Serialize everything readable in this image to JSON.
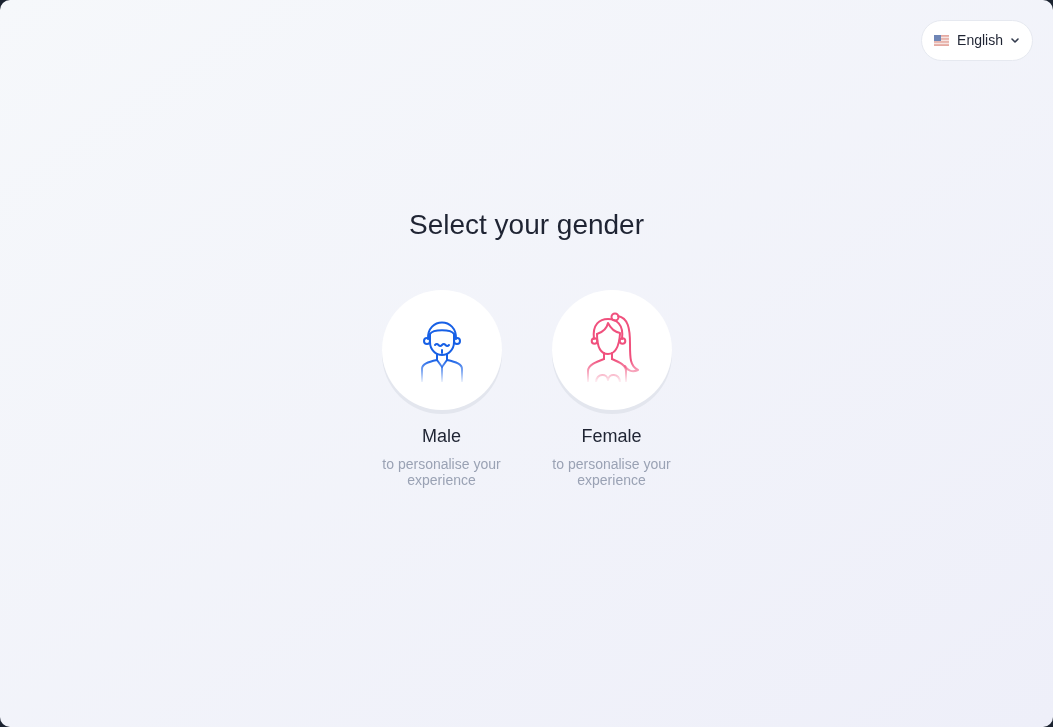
{
  "language_selector": {
    "label": "English"
  },
  "title": "Select your gender",
  "options": [
    {
      "kind": "male",
      "label": "Male",
      "description": "to personalise your experience"
    },
    {
      "kind": "female",
      "label": "Female",
      "description": "to personalise your experience"
    }
  ]
}
